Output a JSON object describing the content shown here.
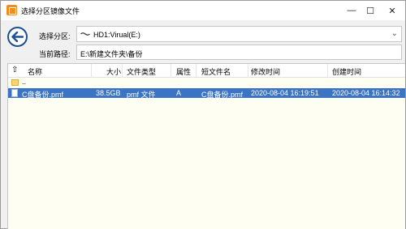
{
  "window": {
    "title": "选择分区镜像文件",
    "controls": {
      "minimize": "—",
      "maximize": "☐",
      "close": "✕"
    }
  },
  "form": {
    "partition_label": "选择分区:",
    "partition_value": "HD1:Virual(E:)",
    "path_label": "当前路径:",
    "path_value": "E:\\新建文件夹\\备份"
  },
  "icons": {
    "back": "back-arrow-icon",
    "app": "app-icon",
    "drive": "drive-icon",
    "folder": "folder-icon",
    "file": "file-icon",
    "sort": "sort-up-icon"
  },
  "colors": {
    "selection": "#3b74c4",
    "list_background": "#fffef2",
    "accent_blue": "#1d4f93",
    "app_orange": "#f28c1b"
  },
  "list": {
    "columns": [
      "名称",
      "大小",
      "文件类型",
      "属性",
      "短文件名",
      "修改时间",
      "创建时间"
    ],
    "sort_glyph": "⇧",
    "parent_label": "..",
    "rows": [
      {
        "name": "C盘备份.pmf",
        "size": "38.5GB",
        "type": "pmf 文件",
        "attr": "A",
        "short_name": "C盘备份.pmf",
        "modified": "2020-08-04 16:19:51",
        "created": "2020-08-04 16:14:32",
        "selected": true
      }
    ]
  }
}
